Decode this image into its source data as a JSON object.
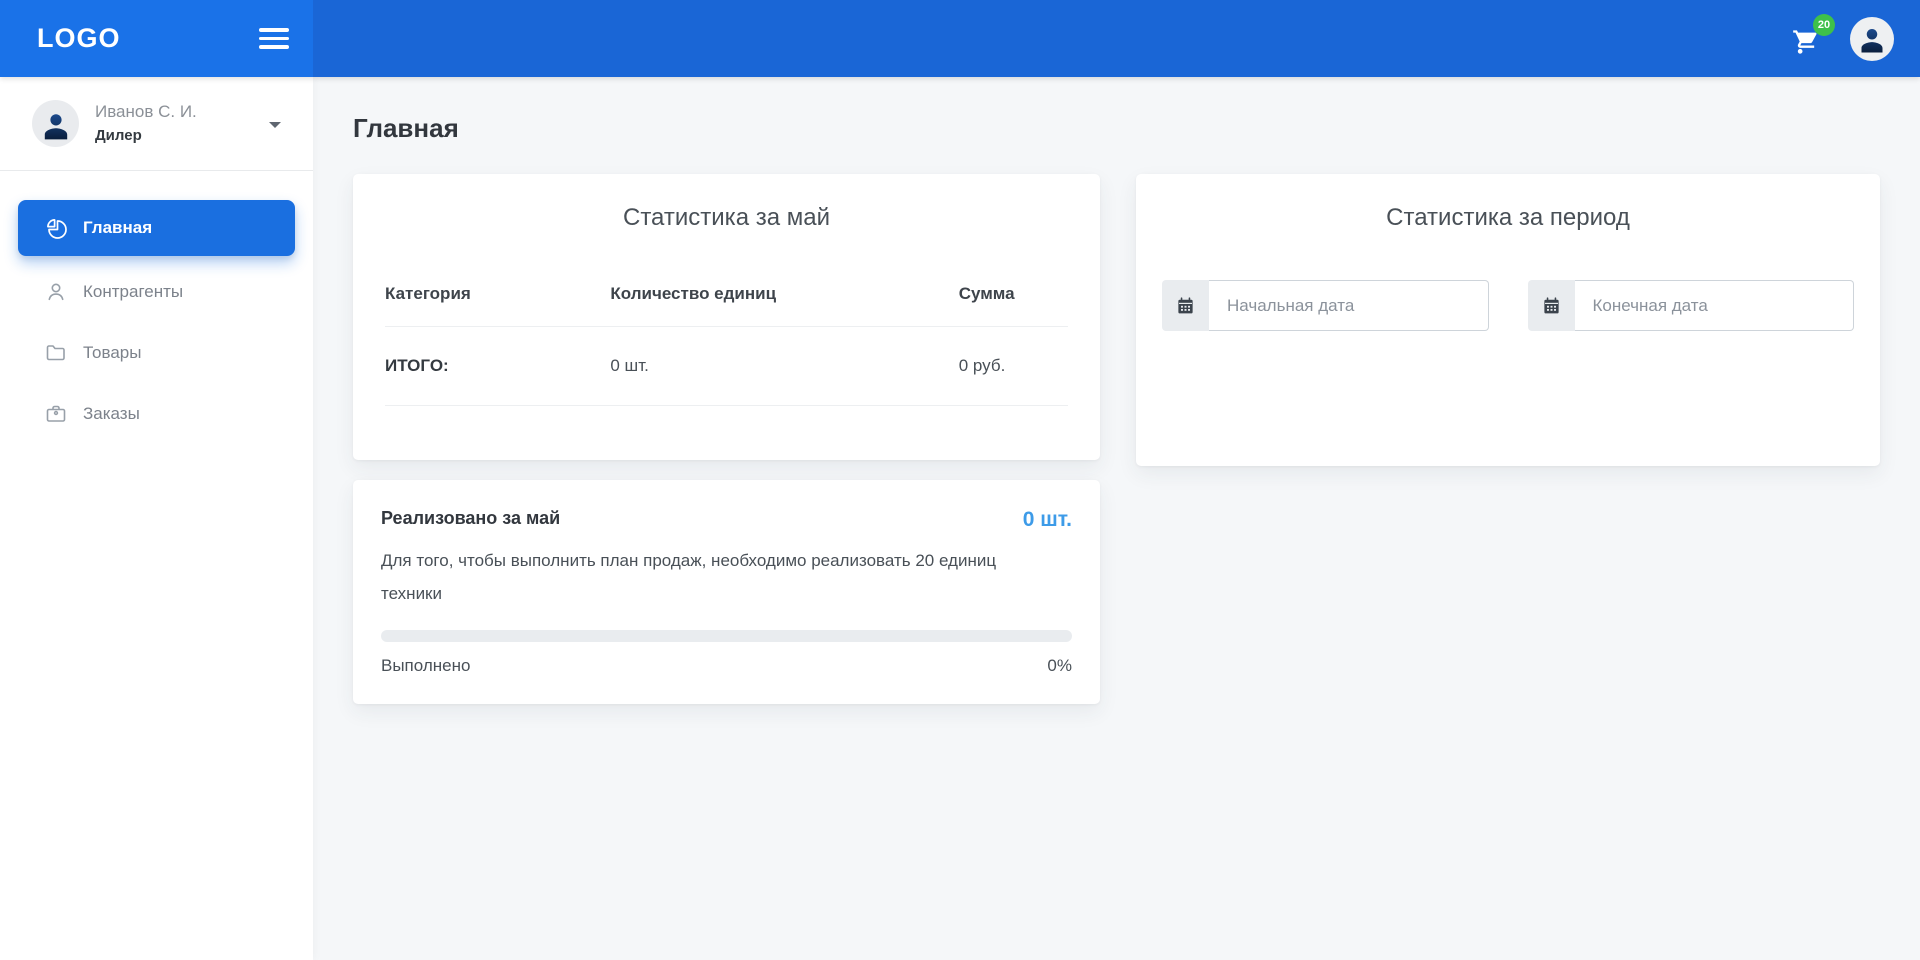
{
  "header": {
    "logo": "LOGO",
    "cart_badge": "20"
  },
  "sidebar": {
    "user": {
      "name": "Иванов С. И.",
      "role": "Дилер"
    },
    "items": [
      {
        "label": "Главная",
        "icon": "pie-chart-icon",
        "active": true
      },
      {
        "label": "Контрагенты",
        "icon": "user-outline-icon",
        "active": false
      },
      {
        "label": "Товары",
        "icon": "folder-icon",
        "active": false
      },
      {
        "label": "Заказы",
        "icon": "briefcase-icon",
        "active": false
      }
    ]
  },
  "main": {
    "page_title": "Главная",
    "stats_month_card": {
      "title": "Статистика за май",
      "table": {
        "headers": [
          "Категория",
          "Количество единиц",
          "Сумма"
        ],
        "rows": [
          [
            "ИТОГО:",
            "0 шт.",
            "0 руб."
          ]
        ]
      }
    },
    "stats_period_card": {
      "title": "Статистика за период",
      "start_date_placeholder": "Начальная дата",
      "end_date_placeholder": "Конечная дата",
      "start_date_value": "",
      "end_date_value": ""
    },
    "sales_card": {
      "title": "Реализовано за май",
      "value": "0 шт.",
      "description": "Для того, чтобы выполнить план продаж, необходимо реализовать 20 единиц техники",
      "progress_label": "Выполнено",
      "progress_value": "0%",
      "progress_percent": 0
    }
  },
  "icons": {
    "hamburger-icon": "three-bars",
    "cart-icon": "shopping-cart",
    "user-icon": "person-silhouette",
    "chevron-down-icon": "▾",
    "pie-chart-icon": "pie-with-slice",
    "user-outline-icon": "person-outline",
    "folder-icon": "folder-outline",
    "briefcase-icon": "briefcase-outline",
    "calendar-icon": "calendar-solid"
  },
  "colors": {
    "sidebar_header_blue": "#1a72e8",
    "header_blue": "#1a66d6",
    "active_item_blue": "#1a6fe0",
    "accent_blue": "#3d9be8",
    "badge_green": "#3ec04a",
    "content_bg": "#f5f7f9",
    "progress_track": "#e9ecef"
  }
}
